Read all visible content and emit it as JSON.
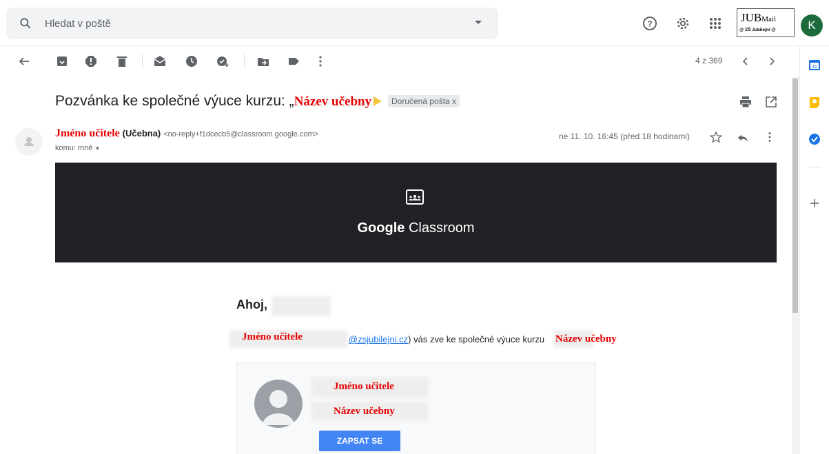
{
  "search": {
    "placeholder": "Hledat v poště"
  },
  "header": {
    "logo_main": "JUB",
    "logo_sub": "Mail",
    "logo_tagline": "@ ZŠ Jubilejní @",
    "avatar_initial": "K"
  },
  "toolbar": {
    "pager": "4 z 369"
  },
  "email": {
    "subject_prefix": "Pozvánka ke společné výuce kurzu: „",
    "subject_course": "Název učebny",
    "label": "Doručená pošta",
    "label_close": "x",
    "sender_name": "Jméno učitele",
    "sender_org": "(Učebna)",
    "sender_address": "<no-reply+f1dcecb5@classroom.google.com>",
    "recipient": "komu: mně",
    "date": "ne 11. 10. 16:45 (před 18 hodinami)"
  },
  "banner": {
    "brand_google": "Google",
    "brand_classroom": "Classroom"
  },
  "body": {
    "greeting": "Ahoj,",
    "teacher_name": "Jméno učitele",
    "email_domain": "@zsjubilejni.cz",
    "invite_text": ") vás zve ke společné výuce kurzu",
    "course_name": "Název učebny",
    "card_teacher": "Jméno učitele",
    "card_course": "Název učebny",
    "join_button": "ZAPSAT SE"
  },
  "colors": {
    "accent_blue": "#4285f4",
    "redaction_red": "#e60000",
    "avatar_green": "#1d6b3c",
    "banner_dark": "#202124"
  }
}
